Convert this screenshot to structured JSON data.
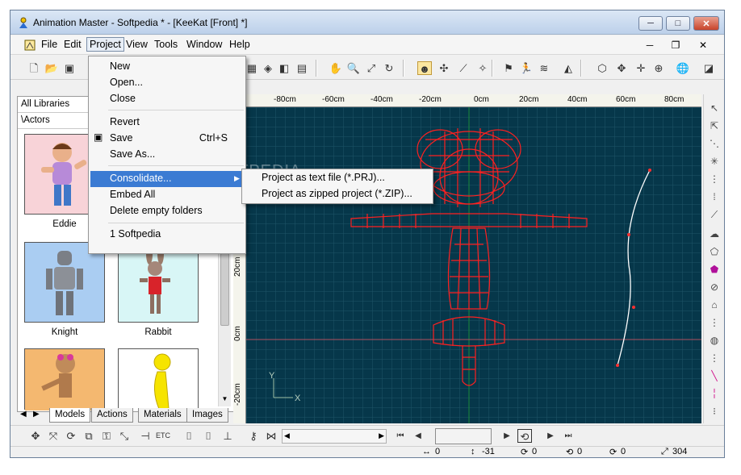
{
  "window": {
    "title": "Animation Master - Softpedia * - [KeeKat [Front] *]",
    "minimize": "─",
    "maximize": "□",
    "close": "✕"
  },
  "menubar": {
    "items": [
      "File",
      "Edit",
      "Project",
      "View",
      "Tools",
      "Window",
      "Help"
    ],
    "open_menu": "Project",
    "mdi_minimize": "─",
    "mdi_restore": "❐",
    "mdi_close": "✕"
  },
  "project_menu": {
    "items": [
      "New",
      "Open...",
      "Close",
      "Revert",
      "Save",
      "Save As...",
      "Consolidate...",
      "Embed All",
      "Delete empty folders",
      "1 Softpedia"
    ],
    "save_shortcut": "Ctrl+S",
    "highlighted": "Consolidate...",
    "submenu_arrow": "▶"
  },
  "consolidate_submenu": {
    "items": [
      "Project as text file (*.PRJ)...",
      "Project as zipped project (*.ZIP)..."
    ]
  },
  "library": {
    "selector": "All Libraries",
    "path": "\\Actors",
    "models": [
      {
        "name": "Eddie",
        "bg": "#f8d3d8"
      },
      {
        "name": "Knight",
        "bg": "#aacdf2"
      },
      {
        "name": "Rabbit",
        "bg": "#d8f6f6"
      },
      {
        "name": "",
        "bg": "#f4b870"
      },
      {
        "name": "",
        "bg": "#ffffff"
      }
    ],
    "tabs": [
      "Models",
      "Actions",
      "Materials",
      "Images"
    ],
    "active_tab": "Models"
  },
  "ruler": {
    "top_labels": [
      "-80cm",
      "-60cm",
      "-40cm",
      "-20cm",
      "0cm",
      "20cm",
      "40cm",
      "60cm",
      "80cm"
    ],
    "left_labels": [
      "20cm",
      "0cm",
      "-20cm"
    ]
  },
  "viewport": {
    "axis_y": "Y",
    "axis_x": "X",
    "watermark": "SOFTPEDIA",
    "colors": {
      "background": "#06374a",
      "grid": "#1f5468",
      "wireframe": "#ff2020",
      "spline": "#ffffff"
    }
  },
  "status": {
    "x": "0",
    "y": "-31",
    "rot1": "0",
    "rot2": "0",
    "rot3": "0",
    "zoom": "304"
  }
}
